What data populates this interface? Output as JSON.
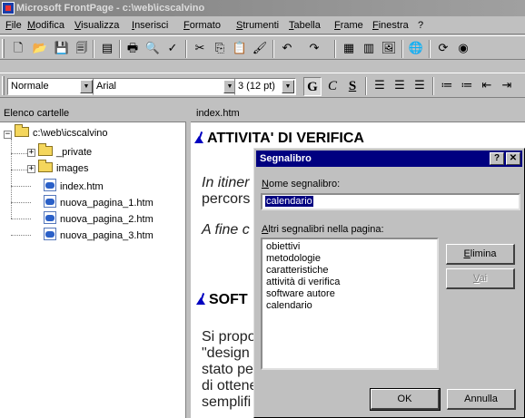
{
  "window": {
    "title": "Microsoft FrontPage - c:\\web\\icscalvino"
  },
  "menu": {
    "items": [
      "File",
      "Modifica",
      "Visualizza",
      "Inserisci",
      "Formato",
      "Strumenti",
      "Tabella",
      "Frame",
      "Finestra",
      "?"
    ]
  },
  "toolbar": {
    "style_value": "Normale",
    "font_value": "Arial",
    "size_value": "3  (12 pt)"
  },
  "folder_pane": {
    "header": "Elenco cartelle",
    "root": "c:\\web\\icscalvino",
    "folders": [
      "_private",
      "images"
    ],
    "files": [
      "index.htm",
      "nuova_pagina_1.htm",
      "nuova_pagina_2.htm",
      "nuova_pagina_3.htm"
    ]
  },
  "editor": {
    "tab_label": "index.htm",
    "heading_1": "ATTIVITA' DI VERIFICA",
    "line_1": "In itiner",
    "line_2": "percors",
    "line_3": "A fine c",
    "heading_2": "SOFT",
    "para_lines": [
      "Si propo",
      "\"design",
      "stato pe",
      "di ottene",
      "semplifi"
    ]
  },
  "dialog": {
    "title": "Segnalibro",
    "help_label": "?",
    "close_label": "✕",
    "name_label": "Nome segnalibro:",
    "name_value": "calendario",
    "list_label": "Altri segnalibri nella pagina:",
    "bookmarks": [
      "obiettivi",
      "metodologie",
      "caratteristiche",
      "attività di verifica",
      "software autore",
      "calendario"
    ],
    "delete_label": "Elimina",
    "goto_label": "Vai",
    "ok_label": "OK",
    "cancel_label": "Annulla"
  }
}
